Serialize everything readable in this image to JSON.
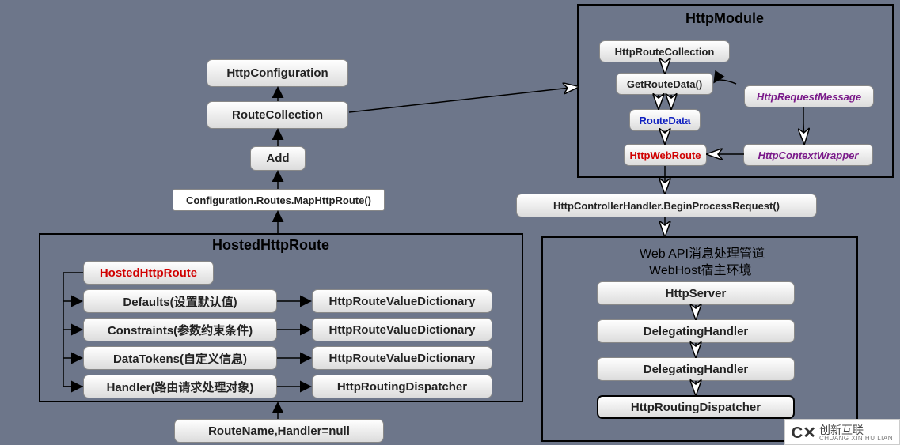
{
  "left": {
    "httpConfig": "HttpConfiguration",
    "routeCollection": "RouteCollection",
    "add": "Add",
    "mapRoute": "Configuration.Routes.MapHttpRoute()",
    "frameTitle": "HostedHttpRoute",
    "hostedRoute": "HostedHttpRoute",
    "defaults": "Defaults(设置默认值)",
    "constraints": "Constraints(参数约束条件)",
    "dataTokens": "DataTokens(自定义信息)",
    "handler": "Handler(路由请求处理对象)",
    "dict": "HttpRouteValueDictionary",
    "dispatcher": "HttpRoutingDispatcher",
    "routeName": "RouteName,Handler=null"
  },
  "topRight": {
    "frameTitle": "HttpModule",
    "httpRouteCollection": "HttpRouteCollection",
    "getRouteData": "GetRouteData()",
    "routeData": "RouteData",
    "httpWebRoute": "HttpWebRoute",
    "httpRequestMessage": "HttpRequestMessage",
    "httpContextWrapper": "HttpContextWrapper",
    "beginProcess": "HttpControllerHandler.BeginProcessRequest()"
  },
  "bottomRight": {
    "line1": "Web API消息处理管道",
    "line2": "WebHost宿主环境",
    "httpServer": "HttpServer",
    "delegating": "DelegatingHandler",
    "dispatcher": "HttpRoutingDispatcher"
  },
  "logo": {
    "brand": "创新互联",
    "sub": "CHUANG XIN HU LIAN"
  }
}
